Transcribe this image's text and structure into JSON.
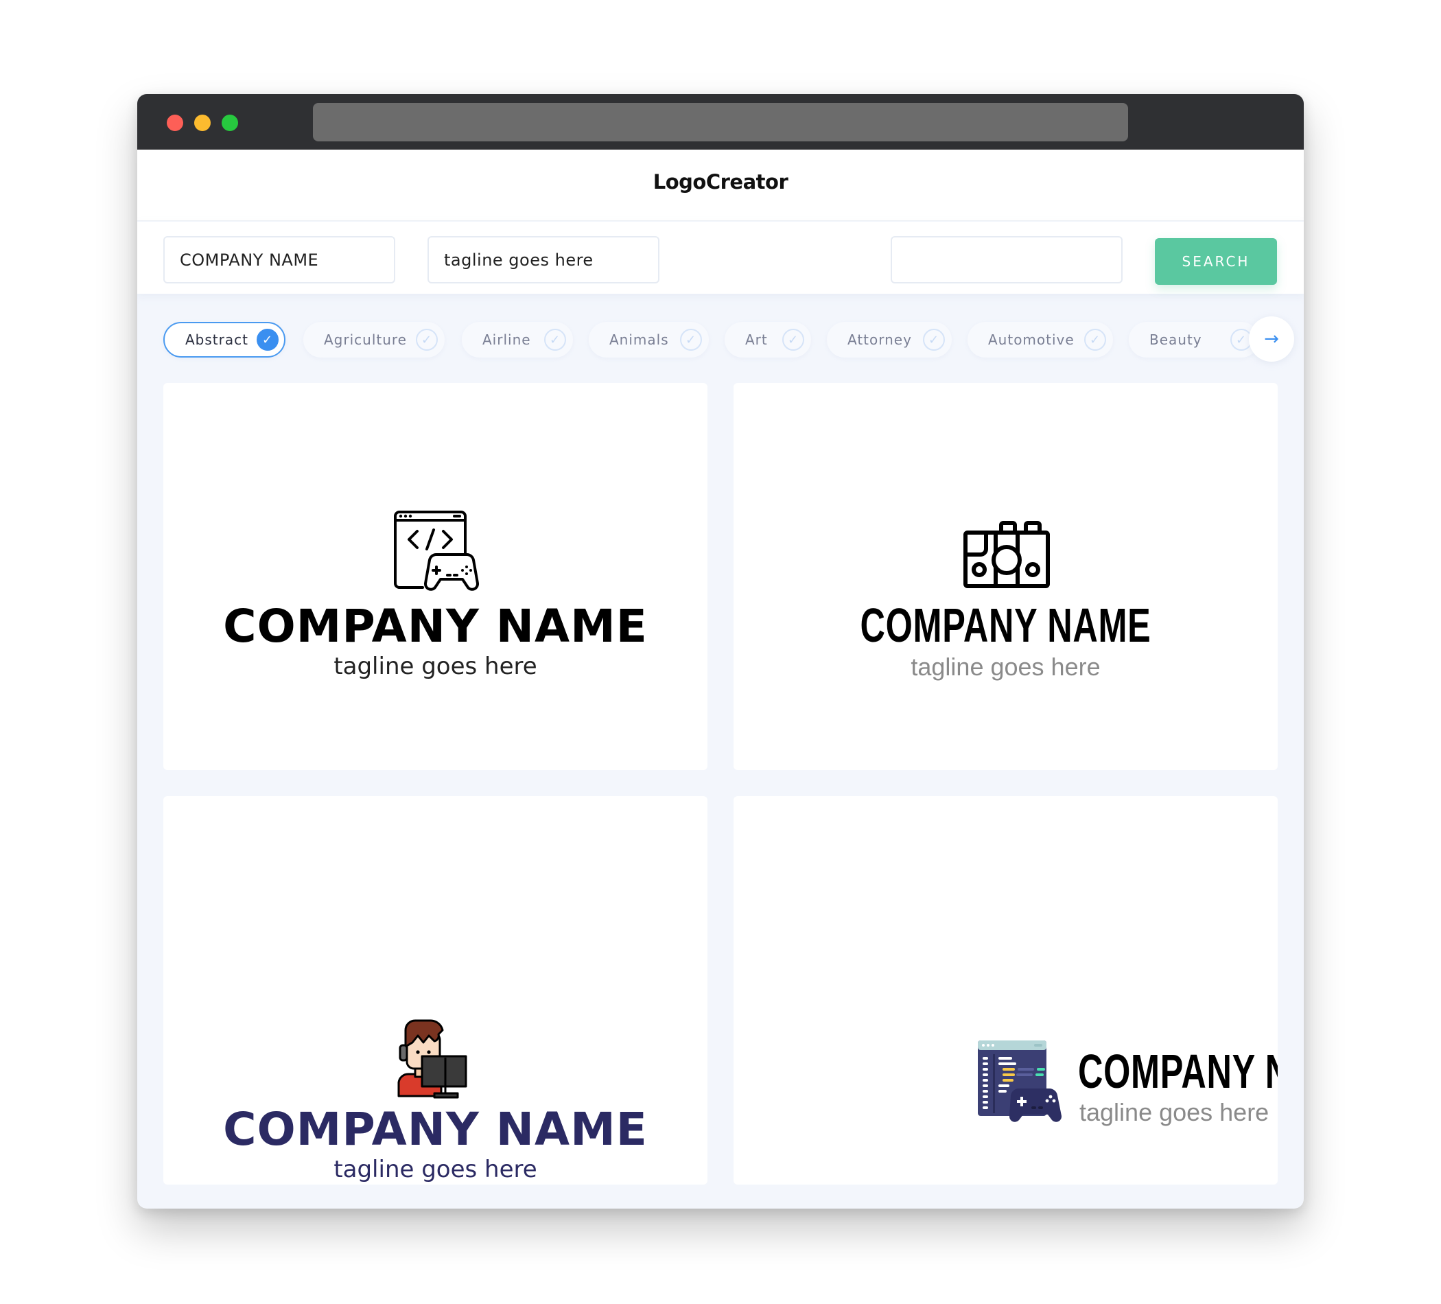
{
  "window": {
    "traffic_lights": [
      "close",
      "minimize",
      "maximize"
    ],
    "address_bar_value": ""
  },
  "header": {
    "title": "LogoCreator"
  },
  "search": {
    "company_name_value": "COMPANY NAME",
    "tagline_value": "tagline goes here",
    "keyword_value": "",
    "search_label": "SEARCH"
  },
  "categories": {
    "items": [
      {
        "label": "Abstract",
        "selected": true
      },
      {
        "label": "Agriculture",
        "selected": false
      },
      {
        "label": "Airline",
        "selected": false
      },
      {
        "label": "Animals",
        "selected": false
      },
      {
        "label": "Art",
        "selected": false
      },
      {
        "label": "Attorney",
        "selected": false
      },
      {
        "label": "Automotive",
        "selected": false
      },
      {
        "label": "Beauty",
        "selected": false
      }
    ],
    "next_icon": "arrow-right-icon"
  },
  "logos": [
    {
      "icon": "code-window-gamepad-icon",
      "company_name": "COMPANY NAME",
      "tagline": "tagline goes here",
      "name_color": "#000000",
      "tagline_color": "#222222"
    },
    {
      "icon": "camera-icon",
      "company_name": "COMPANY NAME",
      "tagline": "tagline goes here",
      "name_color": "#000000",
      "tagline_color": "#8a8a8a"
    },
    {
      "icon": "gamer-at-computer-icon",
      "company_name": "COMPANY NAME",
      "tagline": "tagline goes here",
      "name_color": "#2b2a63",
      "tagline_color": "#2b2a63"
    },
    {
      "icon": "code-editor-gamepad-icon",
      "company_name": "COMPANY NAME",
      "tagline": "tagline goes here",
      "name_color": "#000000",
      "tagline_color": "#8a8a8a"
    }
  ],
  "colors": {
    "accent_blue": "#3a8ff0",
    "search_green": "#5ac8a0",
    "titlebar": "#2f3033",
    "page_background": "#f3f6fc"
  }
}
